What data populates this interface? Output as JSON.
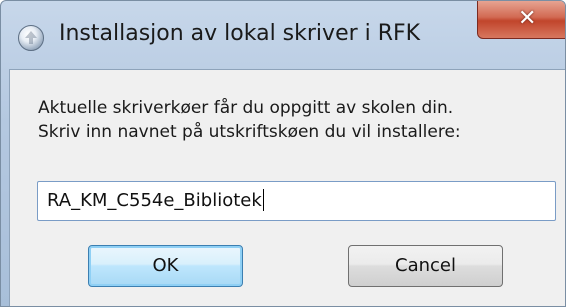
{
  "window": {
    "title": "Installasjon av lokal skriver i RFK",
    "close_label": "✕",
    "app_icon": "printer-setup-icon"
  },
  "dialog": {
    "prompt_line1": "Aktuelle skriverkøer får du oppgitt av skolen din.",
    "prompt_line2": "Skriv inn navnet på utskriftskøen du vil installere:",
    "queue_name_value": "RA_KM_C554e_Bibliotek",
    "ok_label": "OK",
    "cancel_label": "Cancel"
  },
  "colors": {
    "title_bar": "#b4c8e0",
    "close_button": "#c1452b",
    "client_bg": "#f0f0f0",
    "default_button_border": "#3c7fb1"
  }
}
